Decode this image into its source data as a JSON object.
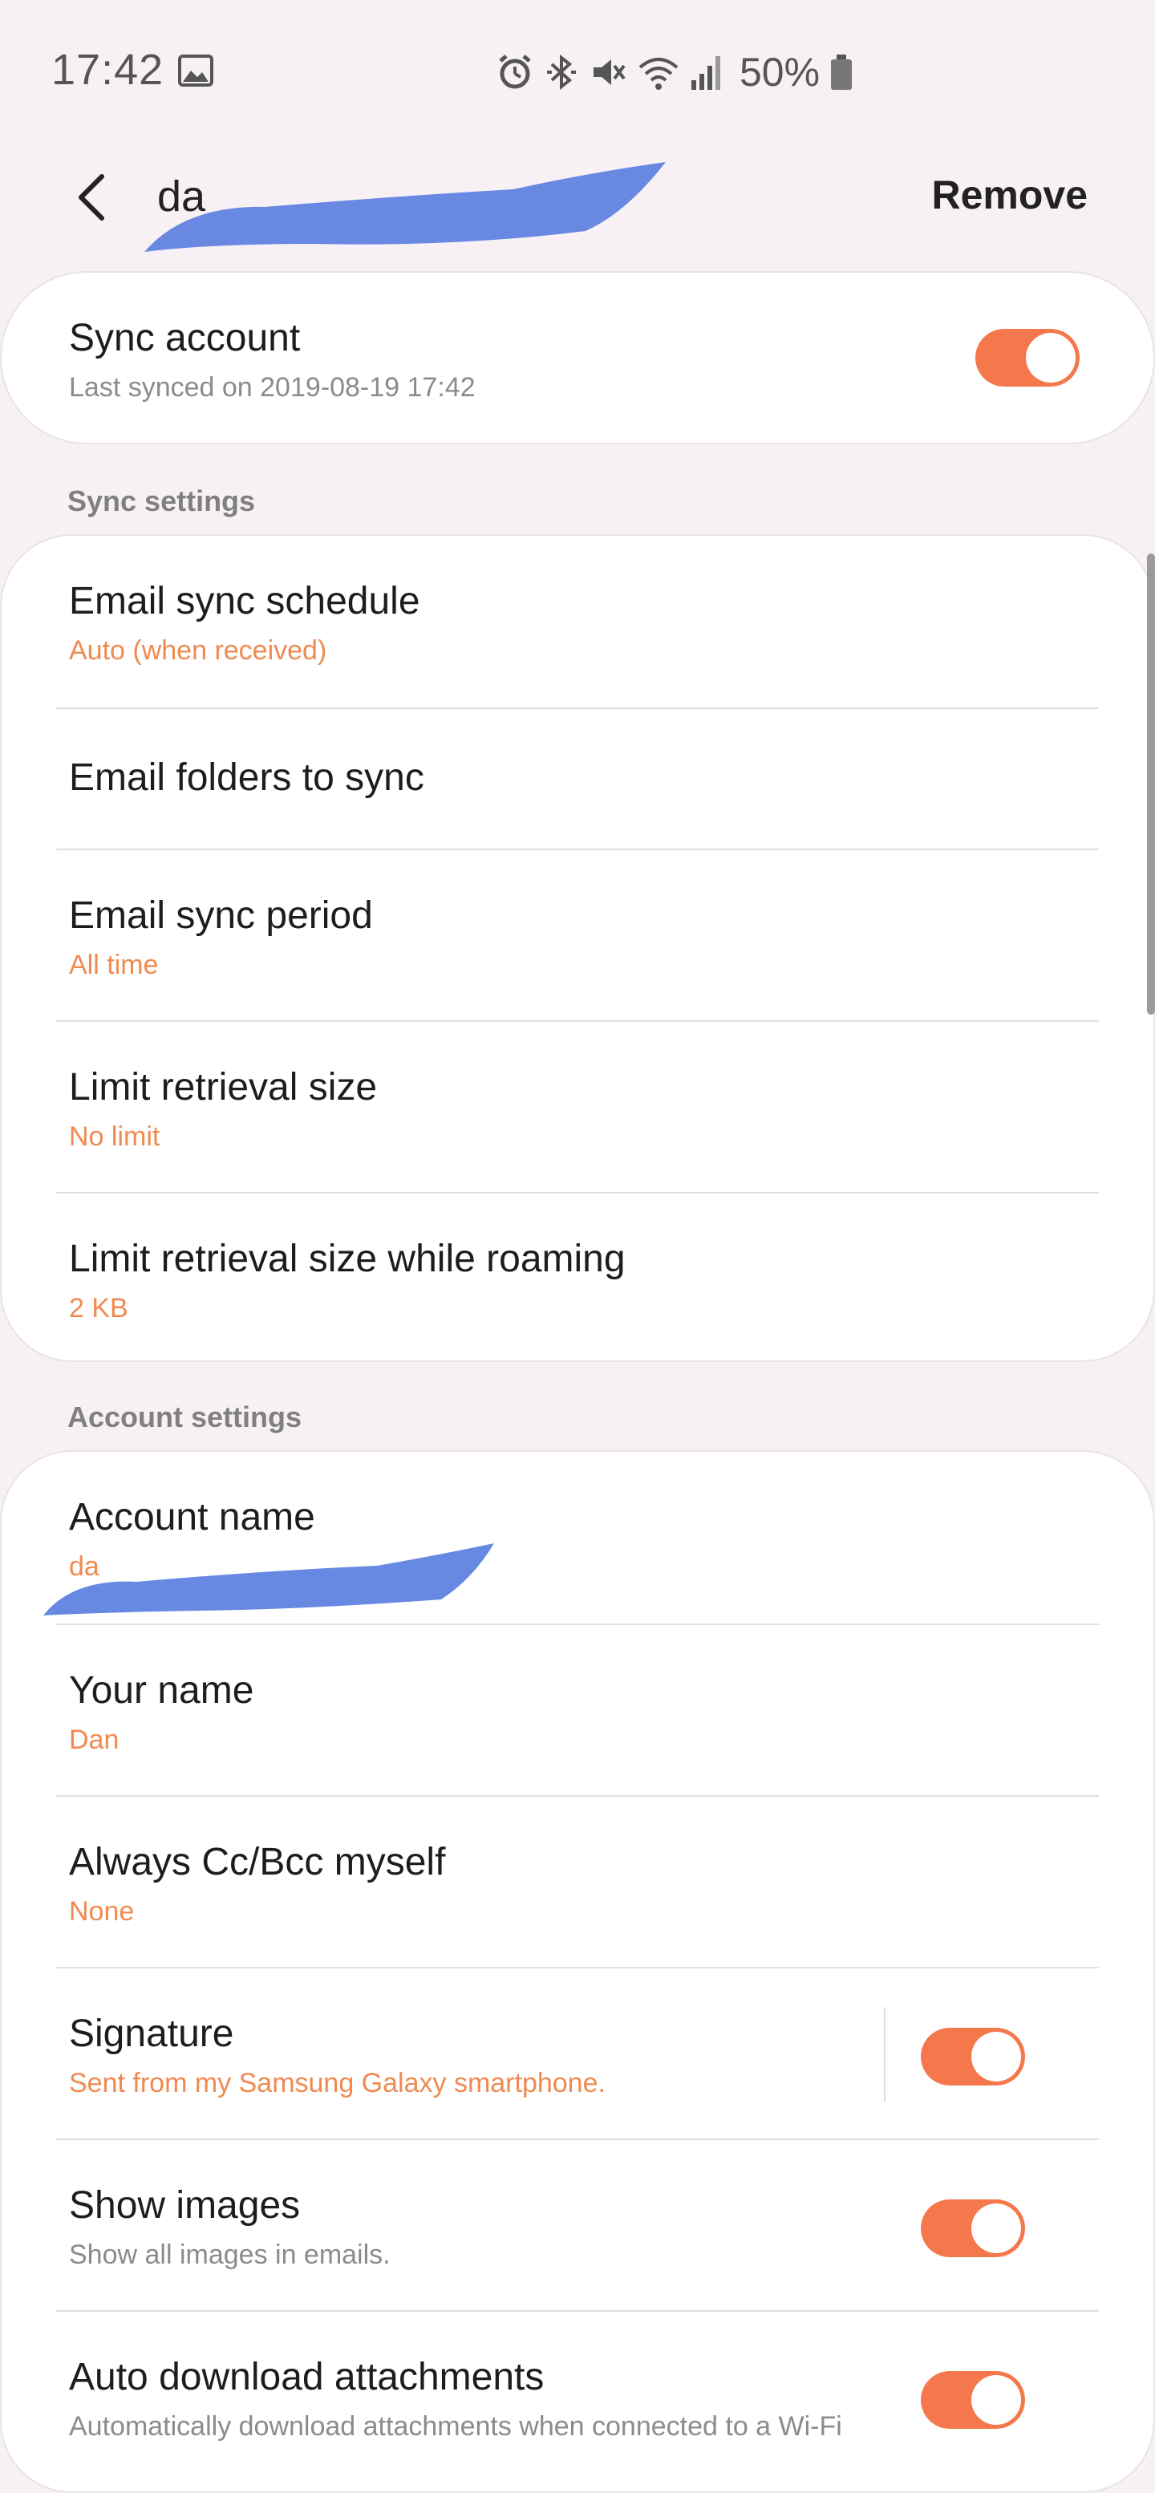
{
  "status_bar": {
    "time": "17:42",
    "battery": "50%",
    "icons": [
      "gallery-icon",
      "alarm-icon",
      "bluetooth-icon",
      "mute-icon",
      "wifi-icon",
      "signal-icon",
      "battery-icon"
    ]
  },
  "header": {
    "back_icon": "back-arrow-icon",
    "account_title": "da",
    "remove_label": "Remove"
  },
  "sync_account": {
    "title": "Sync account",
    "subtitle": "Last synced on 2019-08-19  17:42",
    "enabled": true
  },
  "sync_settings": {
    "header": "Sync settings",
    "items": [
      {
        "title": "Email sync schedule",
        "value": "Auto (when received)"
      },
      {
        "title": "Email folders to sync",
        "value": ""
      },
      {
        "title": "Email sync period",
        "value": "All time"
      },
      {
        "title": "Limit retrieval size",
        "value": "No limit"
      },
      {
        "title": "Limit retrieval size while roaming",
        "value": "2 KB"
      }
    ]
  },
  "account_settings": {
    "header": "Account settings",
    "items": [
      {
        "title": "Account name",
        "value": "da"
      },
      {
        "title": "Your name",
        "value": "Dan"
      },
      {
        "title": "Always Cc/Bcc myself",
        "value": "None"
      },
      {
        "title": "Signature",
        "value": "Sent from my Samsung Galaxy smartphone.",
        "toggle": true
      },
      {
        "title": "Show images",
        "value": "Show all images in emails.",
        "toggle": true
      },
      {
        "title": "Auto download attachments",
        "value": "Automatically download attachments when connected to a Wi-Fi",
        "toggle": true
      }
    ]
  },
  "colors": {
    "accent": "#f4784b",
    "value_text": "#f08a50",
    "background": "#f7f1f5",
    "redaction": "#5b7fe0"
  }
}
